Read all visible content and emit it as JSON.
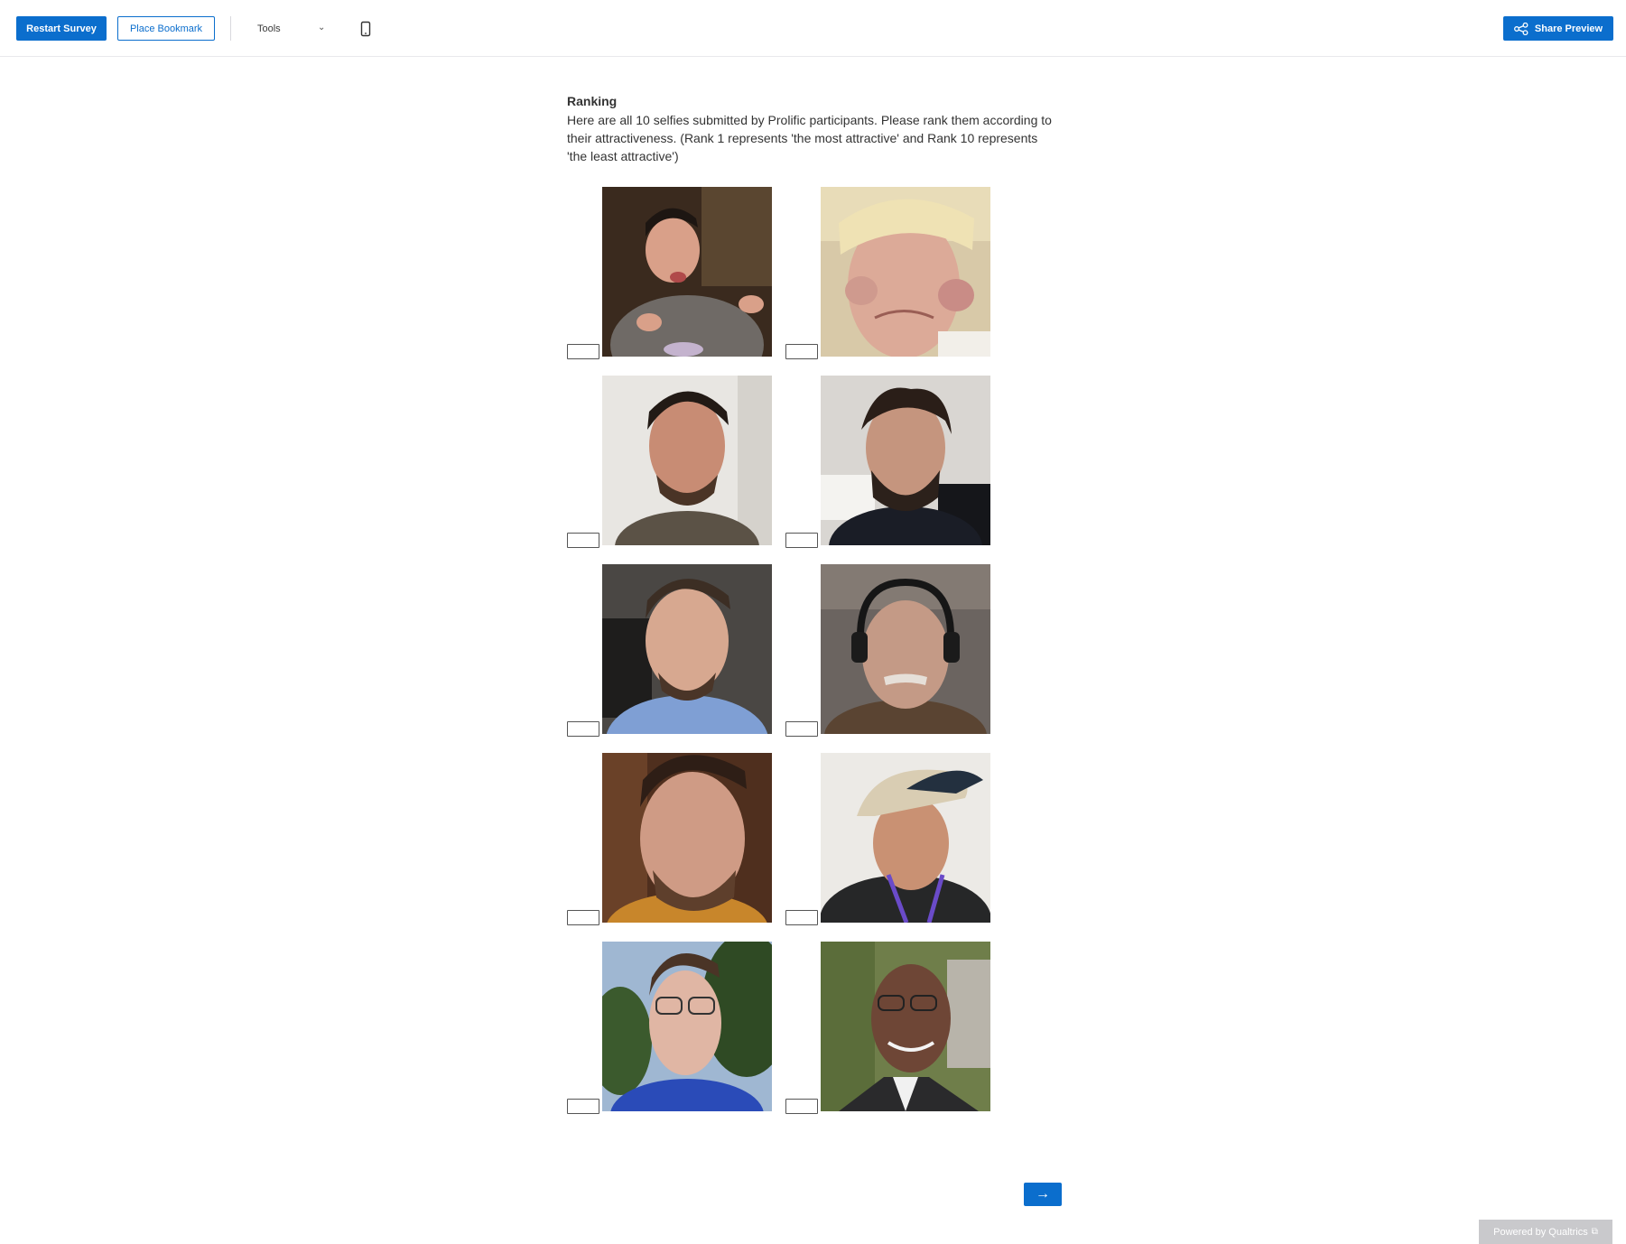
{
  "toolbar": {
    "restart_label": "Restart Survey",
    "bookmark_label": "Place Bookmark",
    "tools_label": "Tools",
    "share_label": "Share Preview"
  },
  "question": {
    "title": "Ranking",
    "text": "Here are all 10 selfies submitted by Prolific participants. Please rank them according to their attractiveness. (Rank 1 represents 'the most attractive' and Rank 10 represents 'the least attractive')"
  },
  "items": [
    {
      "rank": "",
      "photo": "selfie-photo"
    },
    {
      "rank": "",
      "photo": "selfie-photo"
    },
    {
      "rank": "",
      "photo": "selfie-photo"
    },
    {
      "rank": "",
      "photo": "selfie-photo"
    },
    {
      "rank": "",
      "photo": "selfie-photo"
    },
    {
      "rank": "",
      "photo": "selfie-photo"
    },
    {
      "rank": "",
      "photo": "selfie-photo"
    },
    {
      "rank": "",
      "photo": "selfie-photo"
    },
    {
      "rank": "",
      "photo": "selfie-photo"
    },
    {
      "rank": "",
      "photo": "selfie-photo"
    }
  ],
  "navigation": {
    "next_label": "→"
  },
  "footer": {
    "powered_label": "Powered by Qualtrics"
  },
  "colors": {
    "accent": "#0b6ecd",
    "footer_bg": "#c9c9cc"
  },
  "icons": {
    "share": "share-icon",
    "device": "mobile-device-icon",
    "tools_chevron": "chevron-down-icon",
    "external": "external-link-icon"
  }
}
